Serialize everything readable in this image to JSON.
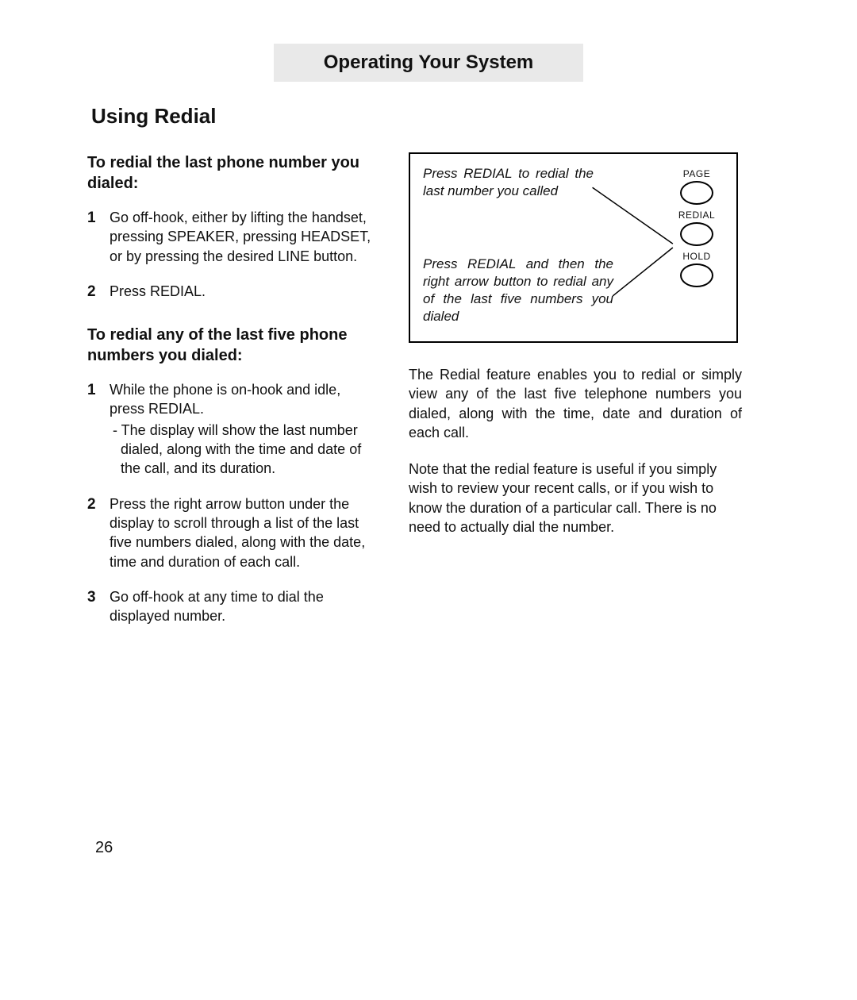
{
  "header": "Operating Your System",
  "section_title": "Using Redial",
  "page_number": "26",
  "left": {
    "h1": "To redial the last phone num­ber you dialed:",
    "list1": {
      "i1": "Go off-hook, either by lifting the handset, pressing SPEAKER, press­ing HEADSET, or by pressing the desired LINE button.",
      "i2": "Press REDIAL."
    },
    "h2": "To redial any of the last five phone numbers you dialed:",
    "list2": {
      "i1": "While the phone is on-hook and idle, press REDIAL.",
      "i1sub": "- The display will show the last num­ber dialed, along with the time and date of the call, and its duration.",
      "i2": "Press the right arrow button under the display to scroll through a list of the last five numbers dialed, along with the date, time and duration of each call.",
      "i3": "Go off-hook at any time to dial the displayed number."
    }
  },
  "diagram": {
    "caption1": "Press REDIAL to redial the last num­ber you called",
    "caption2": "Press REDIAL and then the right arrow button to redial any of the last five numbers you dialed",
    "buttons": {
      "page": "PAGE",
      "redial": "REDIAL",
      "hold": "HOLD"
    }
  },
  "right": {
    "p1": "The Redial feature enables you to redial or sim­ply view any of the last five telephone numbers you dialed, along with the time, date and dura­tion of each call.",
    "p2": "Note that the redial feature is useful if you sim­ply wish to review your recent calls, or if you wish to know the duration of a particular call. There is no need to actually dial the number."
  }
}
